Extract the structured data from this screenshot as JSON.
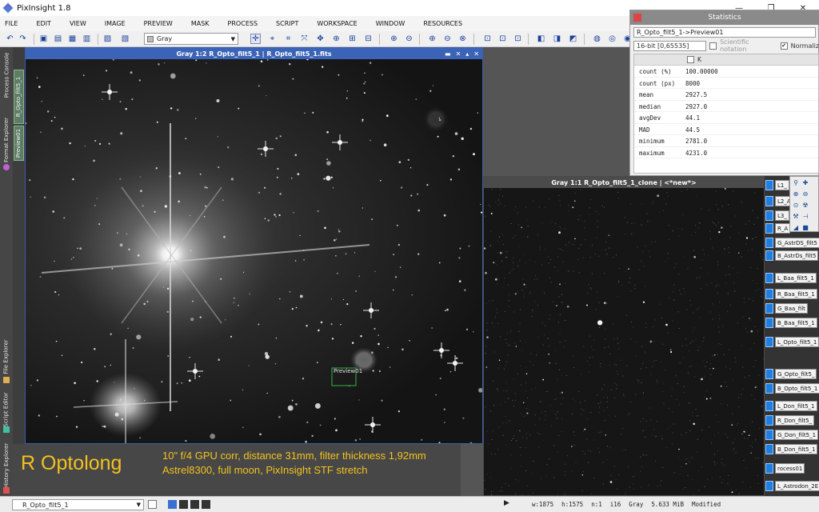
{
  "app": {
    "title": "PixInsight 1.8"
  },
  "window_controls": {
    "minimize": "—",
    "maximize": "❐",
    "close": "✕"
  },
  "menu": [
    "FILE",
    "EDIT",
    "VIEW",
    "IMAGE",
    "PREVIEW",
    "MASK",
    "PROCESS",
    "SCRIPT",
    "WORKSPACE",
    "WINDOW",
    "RESOURCES"
  ],
  "toolbar": {
    "colorspace": "Gray"
  },
  "left_panel_tabs": [
    "Process Console",
    "Format Explorer",
    "File Explorer",
    "Script Editor",
    "History Explorer"
  ],
  "view_tabs": [
    "R_Opto_filt5_1",
    "Preview01"
  ],
  "main_window": {
    "title": "Gray 1:2 R_Opto_filt5_1 | R_Opto_filt5_1.fits",
    "preview_label": "Preview01"
  },
  "caption": {
    "title": "R Optolong",
    "line1": "10\" f/4 GPU corr, distance 31mm, filter thickness 1,92mm",
    "line2": "Astrel8300, full moon, PixInsight STF stretch"
  },
  "clone_window": {
    "title": "Gray 1:1 R_Opto_filt5_1_clone | <*new*>"
  },
  "statistics": {
    "title": "Statistics",
    "view": "R_Opto_filt5_1->Preview01",
    "bit_depth": "16-bit [0,65535]",
    "scientific_notation": "Scientific notation",
    "normalized": "Normaliz",
    "column": "K",
    "rows": [
      {
        "label": "count (%)",
        "value": "100.00000"
      },
      {
        "label": "count (px)",
        "value": "8000"
      },
      {
        "label": "mean",
        "value": "2927.5"
      },
      {
        "label": "median",
        "value": "2927.0"
      },
      {
        "label": "avgDev",
        "value": "44.1"
      },
      {
        "label": "MAD",
        "value": "44.5"
      },
      {
        "label": "minimum",
        "value": "2781.0"
      },
      {
        "label": "maximum",
        "value": "4231.0"
      }
    ]
  },
  "thumbnails": [
    "L1_",
    "L2_A",
    "L3_",
    "R_A",
    "G_AstrDS_filt5",
    "B_AstrDs_filt5",
    "L_Baa_filt5_1",
    "R_Baa_filt5_1",
    "G_Baa_filt",
    "B_Baa_filt5_1",
    "L_Opto_filt5_1",
    "G_Opto_filt5_",
    "B_Opto_filt5_1",
    "L_Don_filt5_1",
    "R_Don_filt5_",
    "G_Don_filt5_1",
    "B_Don_filt5_1",
    "rocess01",
    "L_Astrodon_2E"
  ],
  "statusbar": {
    "view": "R_Opto_filt5_1",
    "width": "w:1875",
    "height": "h:1575",
    "channels": "n:1",
    "depth": "i16",
    "color": "Gray",
    "size": "5.633 MiB",
    "state": "Modified"
  }
}
